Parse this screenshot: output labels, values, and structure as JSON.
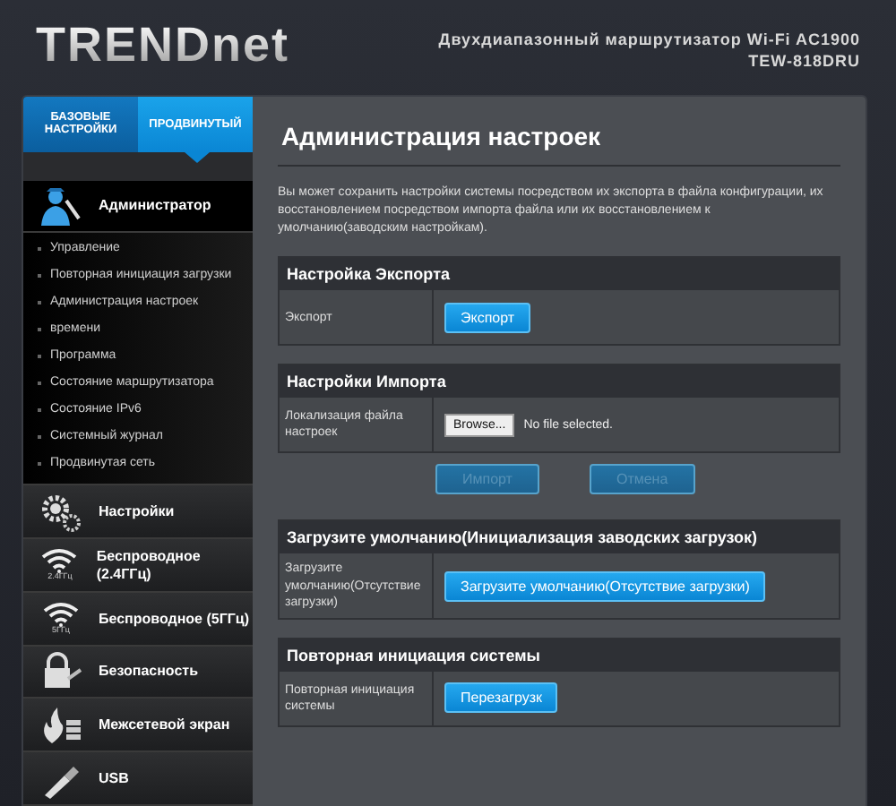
{
  "header": {
    "logo": "TRENDnet",
    "subtitle": "Двухдиапазонный маршрутизатор Wi-Fi AC1900",
    "model": "TEW-818DRU"
  },
  "tabs": [
    {
      "label": "БАЗОВЫЕ НАСТРОЙКИ",
      "selected": false
    },
    {
      "label": "ПРОДВИНУТЫЙ",
      "selected": true
    }
  ],
  "sidebar": {
    "items": [
      {
        "kind": "admin",
        "label": "Администратор",
        "expanded": true,
        "children": [
          {
            "label": "Управление"
          },
          {
            "label": "Повторная инициация загрузки"
          },
          {
            "label": "Администрация настроек"
          },
          {
            "label": "времени"
          },
          {
            "label": "Программа"
          },
          {
            "label": "Состояние маршрутизатора"
          },
          {
            "label": "Состояние IPv6"
          },
          {
            "label": "Системный журнал"
          },
          {
            "label": "Продвинутая сеть"
          }
        ]
      },
      {
        "kind": "gears",
        "label": "Настройки",
        "expanded": false
      },
      {
        "kind": "wifi",
        "label": "Беспроводное (2.4ГГц)",
        "band": "2.4ГГц",
        "expanded": false
      },
      {
        "kind": "wifi",
        "label": "Беспроводное (5ГГц)",
        "band": "5ГГц",
        "expanded": false
      },
      {
        "kind": "lock",
        "label": "Безопасность",
        "expanded": false
      },
      {
        "kind": "fire",
        "label": "Межсетевой экран",
        "expanded": false
      },
      {
        "kind": "usb",
        "label": "USB",
        "expanded": false
      }
    ]
  },
  "content": {
    "title": "Администрация настроек",
    "description": "Вы может сохранить настройки системы посредством их экспорта в файла конфигурации, их восстановлением посредством импорта файла или их восстановлением к умолчанию(заводским настройкам).",
    "sections": [
      {
        "title": "Настройка Экспорта",
        "rows": [
          {
            "kind": "button",
            "label": "Экспорт",
            "button": "Экспорт"
          }
        ]
      },
      {
        "title": "Настройки Импорта",
        "rows": [
          {
            "kind": "file",
            "label": "Локализация файла настроек",
            "browse": "Browse...",
            "file": "No file selected."
          }
        ],
        "actions": [
          {
            "label": "Импорт",
            "disabled": true
          },
          {
            "label": "Отмена",
            "disabled": true
          }
        ]
      },
      {
        "title": "Загрузите умолчанию(Инициализация заводских загрузок)",
        "rows": [
          {
            "kind": "button",
            "label": "Загрузите умолчанию(Отсутствие загрузки)",
            "button": "Загрузите умолчанию(Отсутствие загрузки)"
          }
        ]
      },
      {
        "title": "Повторная инициация системы",
        "rows": [
          {
            "kind": "button",
            "label": "Повторная инициация системы",
            "button": "Перезагрузк"
          }
        ]
      }
    ]
  }
}
